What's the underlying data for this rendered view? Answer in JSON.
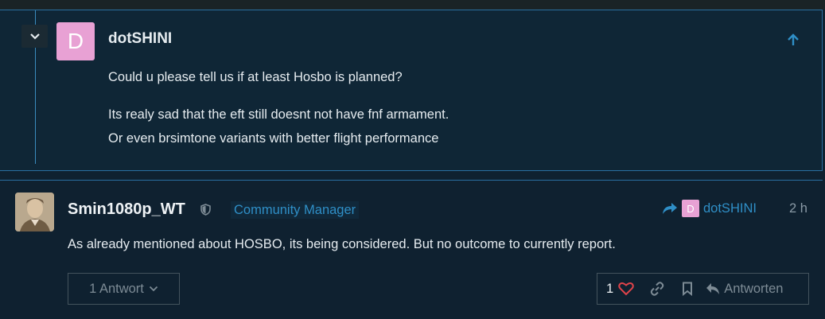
{
  "quoted_post": {
    "avatar_letter": "D",
    "username": "dotSHINI",
    "paragraphs": [
      "Could u please tell us if at least Hosbo is planned?",
      "Its realy sad that the eft still doesnt not have fnf armament.",
      "Or even brsimtone variants with better flight performance"
    ]
  },
  "post": {
    "username": "Smin1080p_WT",
    "role": "Community Manager",
    "reply_to": {
      "avatar_letter": "D",
      "username": "dotSHINI"
    },
    "time": "2 h",
    "text": "As already mentioned about HOSBO, its being considered. But no outcome to currently report.",
    "replies_label": "1 Antwort",
    "like_count": "1",
    "reply_button_label": "Antworten"
  },
  "colors": {
    "accent": "#2f8fc7",
    "like_heart": "#e0434a",
    "avatar_pink": "#e8a1d4",
    "background": "#0f2130"
  }
}
